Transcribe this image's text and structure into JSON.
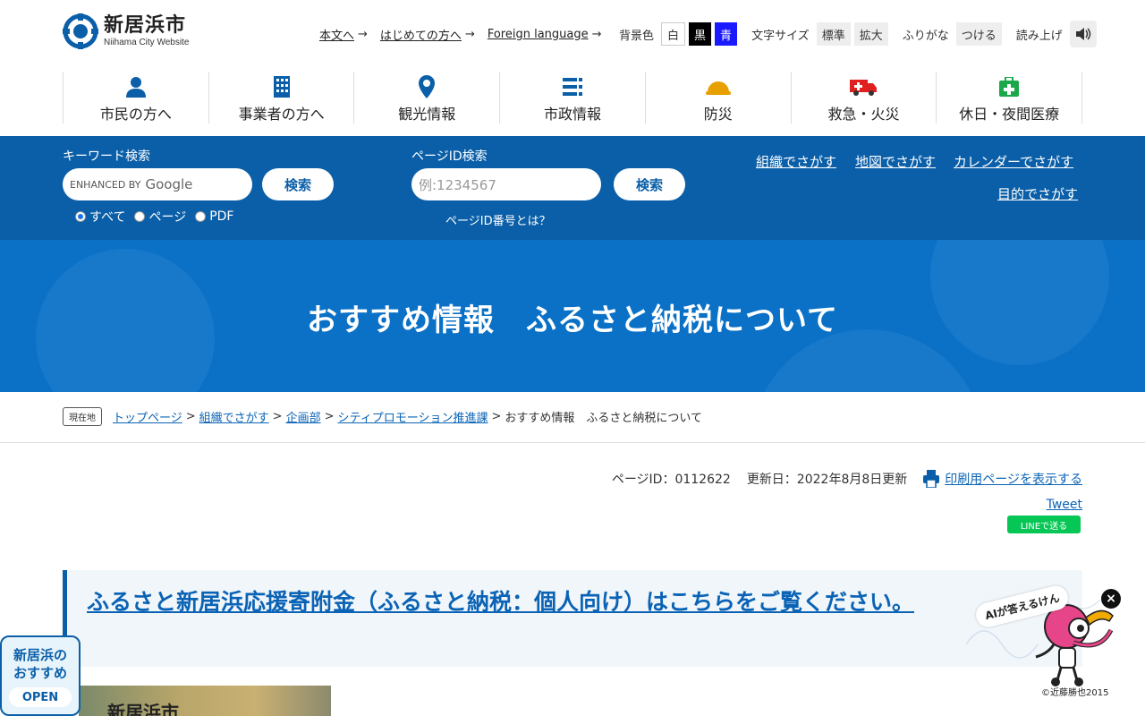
{
  "header": {
    "logo_name": "新居浜市",
    "logo_sub": "Niihama City Website",
    "links": [
      "本文へ",
      "はじめての方へ",
      "Foreign language"
    ],
    "bg_color_label": "背景色",
    "bg_options": [
      "白",
      "黒",
      "青"
    ],
    "font_size_label": "文字サイズ",
    "font_size_options": [
      "標準",
      "拡大"
    ],
    "furigana_label": "ふりがな",
    "furigana_button": "つける",
    "read_aloud_label": "読み上げ"
  },
  "gnav": [
    {
      "label": "市民の方へ",
      "icon": "person-icon"
    },
    {
      "label": "事業者の方へ",
      "icon": "building-icon"
    },
    {
      "label": "観光情報",
      "icon": "map-pin-icon"
    },
    {
      "label": "市政情報",
      "icon": "list-icon"
    },
    {
      "label": "防災",
      "icon": "helmet-icon"
    },
    {
      "label": "救急・火災",
      "icon": "ambulance-icon"
    },
    {
      "label": "休日・夜間医療",
      "icon": "medical-kit-icon"
    }
  ],
  "search": {
    "keyword_label": "キーワード検索",
    "google_enhanced": "ENHANCED BY",
    "google_word": "Google",
    "search_button": "検索",
    "radios": [
      "すべて",
      "ページ",
      "PDF"
    ],
    "pageid_label": "ページID検索",
    "pageid_placeholder": "例:1234567",
    "pageid_button": "検索",
    "pageid_help": "ページID番号とは？",
    "links": [
      "組織でさがす",
      "地図でさがす",
      "カレンダーでさがす",
      "目的でさがす"
    ]
  },
  "hero": {
    "title": "おすすめ情報　ふるさと納税について"
  },
  "breadcrumb": {
    "badge": "現在地",
    "items": [
      "トップページ",
      "組織でさがす",
      "企画部",
      "シティプロモーション推進課"
    ],
    "current": "おすすめ情報　ふるさと納税について"
  },
  "meta": {
    "page_id": "ページID：0112622",
    "updated": "更新日：2022年8月8日更新",
    "print_link": "印刷用ページを表示する",
    "tweet": "Tweet",
    "line": "LINEで送る"
  },
  "content": {
    "callout_link": "ふるさと新居浜応援寄附金（ふるさと納税：個人向け）はこちらをご覧ください。",
    "photo_text": "新居浜市"
  },
  "widgets": {
    "osusume_line1": "新居浜の",
    "osusume_line2": "おすすめ",
    "open": "OPEN",
    "ai_bubble": "AIが答えるけん",
    "ai_copyright": "©近藤勝也2015",
    "close": "×"
  },
  "colors": {
    "band_blue": "#0a5fa8",
    "hero_blue": "#0a71c7",
    "link_blue": "#0b63b5"
  }
}
